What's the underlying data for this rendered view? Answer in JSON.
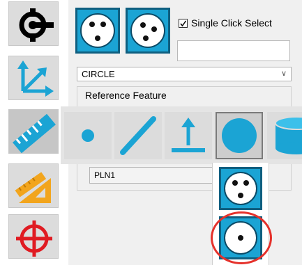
{
  "toolbar": {
    "items": [
      {
        "name": "probe-head",
        "icon": "probe-icon"
      },
      {
        "name": "coordinate-system",
        "icon": "axes-icon"
      },
      {
        "name": "measure",
        "icon": "ruler-icon",
        "active": true
      },
      {
        "name": "construct",
        "icon": "drafting-icon"
      },
      {
        "name": "target",
        "icon": "crosshair-icon"
      }
    ]
  },
  "mode_buttons": [
    {
      "name": "circle-contact-mode",
      "icon": "circle-three-points-icon"
    },
    {
      "name": "circle-auto-mode",
      "icon": "circle-three-points-icon"
    }
  ],
  "single_click": {
    "label": "Single Click Select",
    "checked": true
  },
  "feature_type": {
    "value": "CIRCLE"
  },
  "reference": {
    "title": "Reference Feature",
    "plane_value": "PLN1"
  },
  "feature_bar": [
    {
      "name": "point",
      "icon": "point-icon"
    },
    {
      "name": "line",
      "icon": "line-icon"
    },
    {
      "name": "plane",
      "icon": "plane-icon"
    },
    {
      "name": "circle",
      "icon": "circle-icon",
      "selected": true
    },
    {
      "name": "cylinder",
      "icon": "cylinder-icon"
    }
  ],
  "circle_options": [
    {
      "name": "circle-three-points",
      "icon": "circle-three-points-icon"
    },
    {
      "name": "circle-center-point",
      "icon": "circle-center-point-icon",
      "highlighted": true
    }
  ],
  "colors": {
    "accent": "#1ba4d4",
    "accent_dark": "#0f5f80",
    "highlight": "#e5312b",
    "construct_orange": "#f2a51d",
    "target_red": "#e01b22"
  }
}
